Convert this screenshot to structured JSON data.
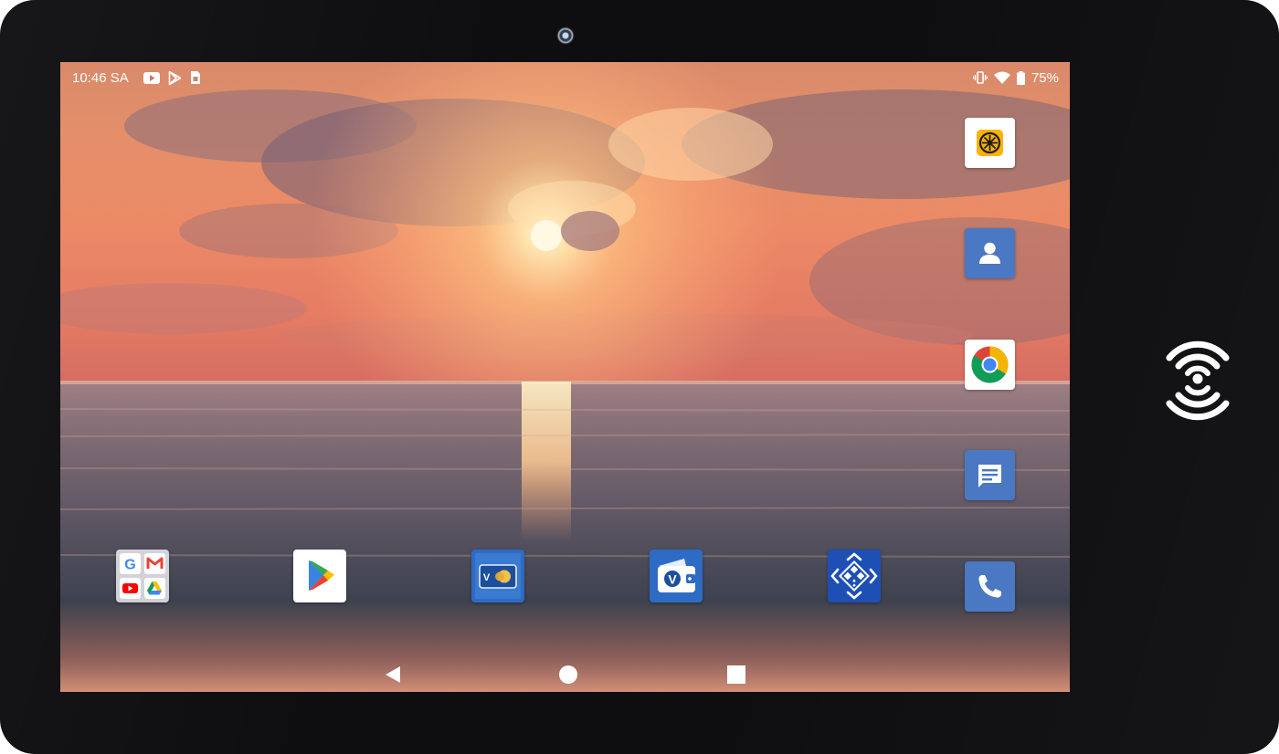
{
  "status_bar": {
    "time": "10:46 SA",
    "battery_percent": "75%",
    "left_icons": [
      "youtube-notification-icon",
      "play-store-notification-icon",
      "sim-card-icon"
    ],
    "right_icons": [
      "vibrate-icon",
      "wifi-icon",
      "battery-icon"
    ]
  },
  "sidebar_apps": [
    {
      "icon": "lemon-app-icon",
      "accent": "#FFB300"
    },
    {
      "icon": "contacts-icon",
      "accent": "#4A78C2"
    },
    {
      "icon": "chrome-icon",
      "accent": "#DB4437"
    },
    {
      "icon": "messages-icon",
      "accent": "#4A78C2"
    },
    {
      "icon": "phone-icon",
      "accent": "#4A78C2"
    }
  ],
  "dock_apps": [
    {
      "icon": "google-apps-folder-icon",
      "folder_apps": [
        "google-icon",
        "gmail-icon",
        "youtube-icon",
        "drive-icon"
      ]
    },
    {
      "icon": "play-store-icon"
    },
    {
      "icon": "vnpay-card-icon",
      "accent": "#2D6BC4"
    },
    {
      "icon": "vnpay-wallet-icon",
      "accent": "#2D6BC4"
    },
    {
      "icon": "qr-scan-icon",
      "accent": "#1E4FB5"
    }
  ],
  "navigation": [
    "back-icon",
    "home-icon",
    "recents-icon"
  ],
  "device": {
    "bezel_color": "#0E0E10",
    "features": [
      "front-camera-icon",
      "nfc-icon"
    ]
  }
}
